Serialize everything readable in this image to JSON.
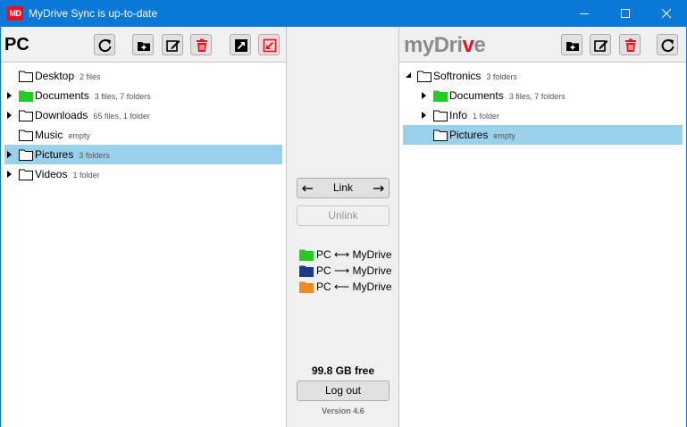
{
  "window": {
    "title": "MyDrive Sync is up-to-date",
    "logo_text": "MD"
  },
  "left_pane": {
    "title": "PC",
    "items": [
      {
        "name": "Desktop",
        "meta": "2 files",
        "expandable": false,
        "color": "plain",
        "selected": false
      },
      {
        "name": "Documents",
        "meta": "3 files, 7 folders",
        "expandable": true,
        "color": "#22cc22",
        "selected": false
      },
      {
        "name": "Downloads",
        "meta": "65 files, 1 folder",
        "expandable": true,
        "color": "plain",
        "selected": false
      },
      {
        "name": "Music",
        "meta": "empty",
        "expandable": false,
        "color": "plain",
        "selected": false
      },
      {
        "name": "Pictures",
        "meta": "3 folders",
        "expandable": true,
        "color": "plain",
        "selected": true
      },
      {
        "name": "Videos",
        "meta": "1 folder",
        "expandable": true,
        "color": "plain",
        "selected": false
      }
    ]
  },
  "right_pane": {
    "brand_part1": "my",
    "brand_part2": "Dri",
    "brand_part3": "v",
    "brand_part4": "e",
    "items": [
      {
        "name": "Softronics",
        "meta": "3 folders",
        "level": 0,
        "arrow": "expanded",
        "color": "plain",
        "selected": false
      },
      {
        "name": "Documents",
        "meta": "3 files, 7 folders",
        "level": 1,
        "arrow": "collapsed",
        "color": "#22cc22",
        "selected": false
      },
      {
        "name": "Info",
        "meta": "1 folder",
        "level": 1,
        "arrow": "collapsed",
        "color": "plain",
        "selected": false
      },
      {
        "name": "Pictures",
        "meta": "empty",
        "level": 1,
        "arrow": "none",
        "color": "plain",
        "selected": true
      }
    ]
  },
  "middle": {
    "link_label": "Link",
    "unlink_label": "Unlink",
    "legend": [
      {
        "color": "#22cc22",
        "text": "PC ⟷ MyDrive"
      },
      {
        "color": "#1a3a8c",
        "text": "PC ⟶ MyDrive"
      },
      {
        "color": "#f08a1c",
        "text": "PC ⟵ MyDrive"
      }
    ],
    "free_space": "99.8 GB free",
    "logout_label": "Log out",
    "version": "Version 4.6"
  },
  "colors": {
    "accent": "#0a78d7",
    "selection": "#99d1eb",
    "danger": "#e81123"
  }
}
